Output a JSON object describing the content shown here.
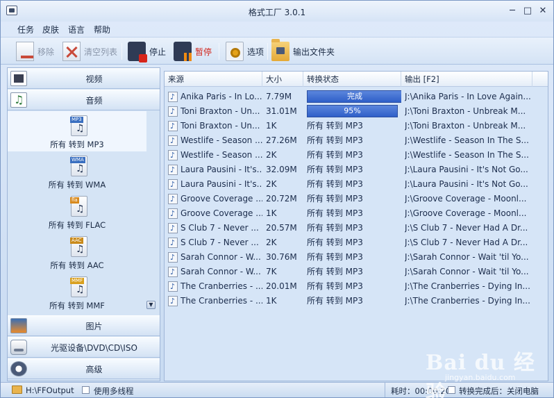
{
  "window": {
    "title": "格式工厂 3.0.1",
    "minimize": "─",
    "maximize": "□",
    "close": "✕"
  },
  "menu": [
    "任务",
    "皮肤",
    "语言",
    "帮助"
  ],
  "toolbar": {
    "remove": "移除",
    "clear_list": "清空列表",
    "stop": "停止",
    "pause": "暂停",
    "options": "选项",
    "output_folder": "输出文件夹"
  },
  "categories": {
    "video": "视频",
    "audio": "音频",
    "image": "图片",
    "disc": "光驱设备\\DVD\\CD\\ISO",
    "advanced": "高级"
  },
  "audio_formats": [
    {
      "tag": "MP3",
      "label": "所有 转到 MP3"
    },
    {
      "tag": "WMA",
      "label": "所有 转到 WMA"
    },
    {
      "tag": "fla",
      "label": "所有 转到 FLAC"
    },
    {
      "tag": "AAC",
      "label": "所有 转到 AAC"
    },
    {
      "tag": "MMF",
      "label": "所有 转到 MMF"
    }
  ],
  "list": {
    "columns": [
      "来源",
      "大小",
      "转换状态",
      "输出 [F2]"
    ],
    "rows": [
      {
        "source": "Anika Paris - In Lo...",
        "size": "7.79M",
        "status": "完成",
        "progress": 100,
        "output": "J:\\Anika Paris - In Love Again..."
      },
      {
        "source": "Toni Braxton - Un...",
        "size": "31.01M",
        "status": "95%",
        "progress": 95,
        "output": "J:\\Toni Braxton - Unbreak M..."
      },
      {
        "source": "Toni Braxton - Un...",
        "size": "1K",
        "status": "所有 转到 MP3",
        "output": "J:\\Toni Braxton - Unbreak M..."
      },
      {
        "source": "Westlife - Season ...",
        "size": "27.26M",
        "status": "所有 转到 MP3",
        "output": "J:\\Westlife - Season In The S..."
      },
      {
        "source": "Westlife - Season ...",
        "size": "2K",
        "status": "所有 转到 MP3",
        "output": "J:\\Westlife - Season In The S..."
      },
      {
        "source": "Laura Pausini - It's...",
        "size": "32.09M",
        "status": "所有 转到 MP3",
        "output": "J:\\Laura Pausini - It's Not Go..."
      },
      {
        "source": "Laura Pausini - It's...",
        "size": "2K",
        "status": "所有 转到 MP3",
        "output": "J:\\Laura Pausini - It's Not Go..."
      },
      {
        "source": "Groove Coverage ...",
        "size": "20.72M",
        "status": "所有 转到 MP3",
        "output": "J:\\Groove Coverage - Moonl..."
      },
      {
        "source": "Groove Coverage ...",
        "size": "1K",
        "status": "所有 转到 MP3",
        "output": "J:\\Groove Coverage - Moonl..."
      },
      {
        "source": "S Club 7 - Never ...",
        "size": "20.57M",
        "status": "所有 转到 MP3",
        "output": "J:\\S Club 7 - Never Had A Dr..."
      },
      {
        "source": "S Club 7 - Never ...",
        "size": "2K",
        "status": "所有 转到 MP3",
        "output": "J:\\S Club 7 - Never Had A Dr..."
      },
      {
        "source": "Sarah Connor - W...",
        "size": "30.76M",
        "status": "所有 转到 MP3",
        "output": "J:\\Sarah Connor - Wait 'til Yo..."
      },
      {
        "source": "Sarah Connor - W...",
        "size": "7K",
        "status": "所有 转到 MP3",
        "output": "J:\\Sarah Connor - Wait 'til Yo..."
      },
      {
        "source": "The Cranberries - ...",
        "size": "20.01M",
        "status": "所有 转到 MP3",
        "output": "J:\\The Cranberries - Dying In..."
      },
      {
        "source": "The Cranberries - ...",
        "size": "1K",
        "status": "所有 转到 MP3",
        "output": "J:\\The Cranberries - Dying In..."
      }
    ]
  },
  "statusbar": {
    "output_path": "H:\\FFOutput",
    "multithread": "使用多线程",
    "elapsed": "耗时：00:00:20",
    "after_done": "转换完成后：关闭电脑"
  },
  "watermark": {
    "main": "Bai du 经验",
    "sub": "jingyan.baidu.com"
  }
}
